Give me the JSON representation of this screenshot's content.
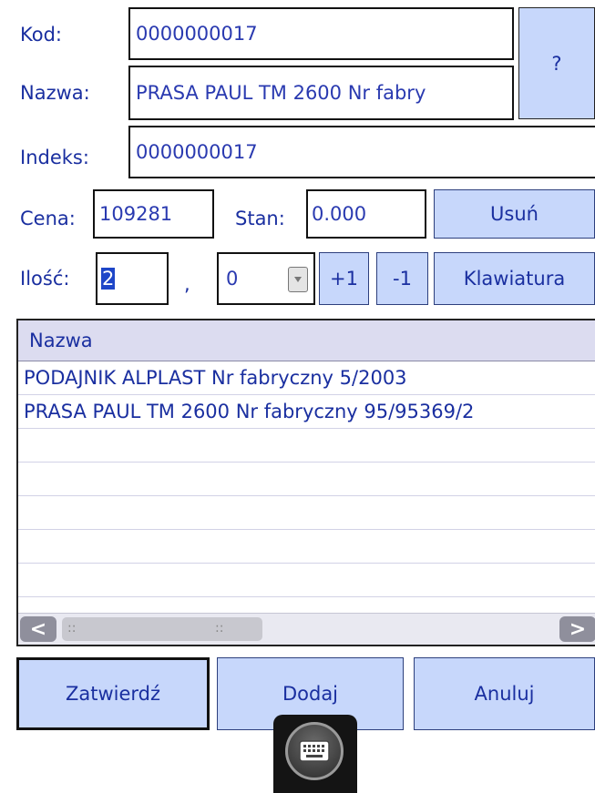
{
  "form": {
    "kod_label": "Kod:",
    "kod_value": "0000000017",
    "nazwa_label": "Nazwa:",
    "nazwa_value": "PRASA PAUL TM 2600 Nr fabry",
    "indeks_label": "Indeks:",
    "indeks_value": "0000000017",
    "cena_label": "Cena:",
    "cena_value": "109281",
    "stan_label": "Stan:",
    "stan_value": "0.000",
    "ilosc_label": "Ilość:",
    "ilosc_value": "2",
    "separator": ",",
    "ilosc_decimal": "0"
  },
  "buttons": {
    "help": "?",
    "usun": "Usuń",
    "plus": "+1",
    "minus": "-1",
    "klawiatura": "Klawiatura",
    "zatwierdz": "Zatwierdź",
    "dodaj": "Dodaj",
    "anuluj": "Anuluj"
  },
  "list": {
    "header": "Nazwa",
    "rows": [
      "PODAJNIK ALPLAST Nr fabryczny 5/2003",
      "PRASA PAUL TM 2600 Nr fabryczny 95/95369/2",
      "",
      "",
      "",
      "",
      "",
      ""
    ]
  },
  "scrollbar": {
    "left_arrow": "<",
    "right_arrow": ">",
    "thumb_grip": "::"
  },
  "icons": {
    "dropdown": "dropdown-arrow-icon",
    "keyboard": "keyboard-icon"
  },
  "colors": {
    "button_fill": "#c7d7fb",
    "text": "#1a2fa0",
    "selection": "#1e46c8"
  }
}
